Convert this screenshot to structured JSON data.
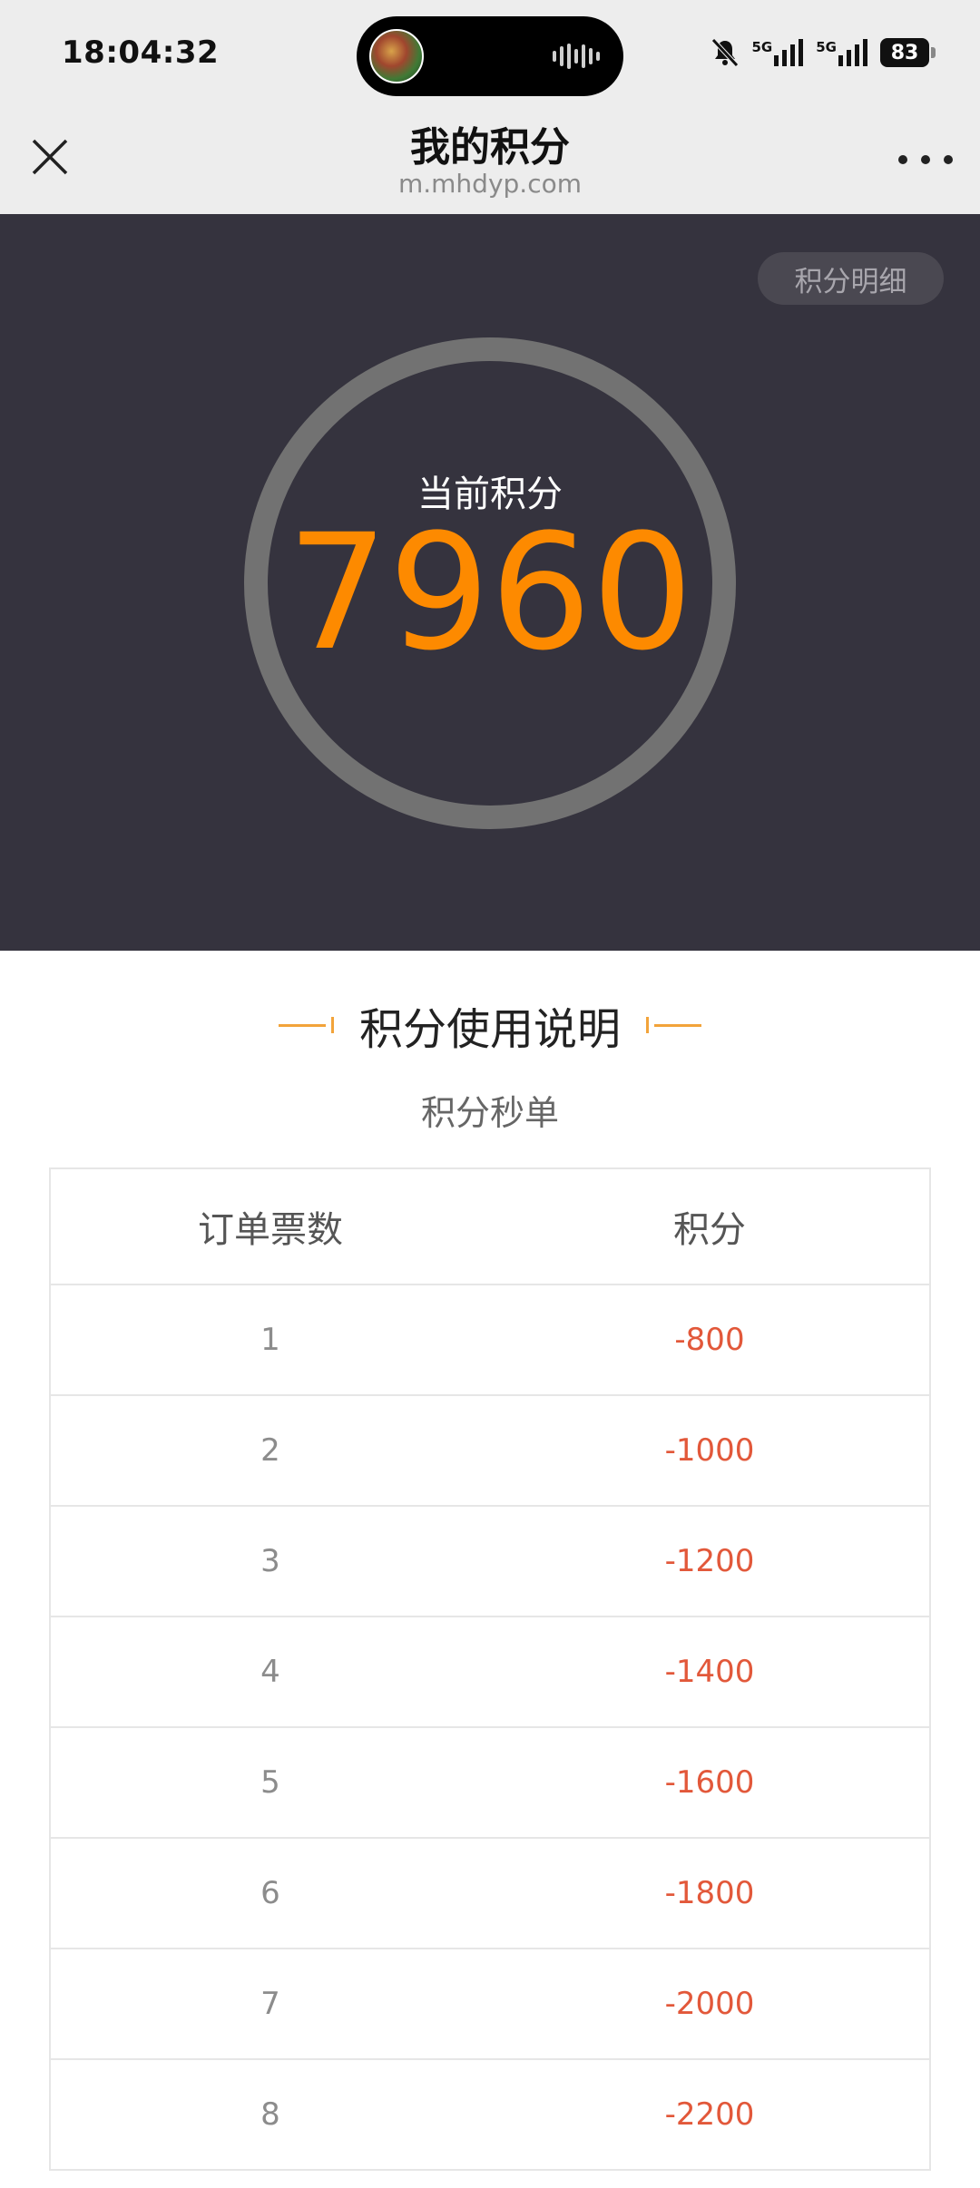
{
  "status_bar": {
    "time": "18:04:32",
    "network1": "5G",
    "network2": "5G",
    "battery": "83",
    "icons": [
      "bell-muted-icon",
      "signal-icon",
      "signal-icon",
      "battery-icon"
    ]
  },
  "nav": {
    "title": "我的积分",
    "subtitle": "m.mhdyp.com"
  },
  "hero": {
    "detail_button": "积分明细",
    "label": "当前积分",
    "points": "7960"
  },
  "section": {
    "title": "积分使用说明",
    "subtitle": "积分秒单"
  },
  "table": {
    "headers": [
      "订单票数",
      "积分"
    ],
    "rows": [
      {
        "tickets": "1",
        "points": "-800"
      },
      {
        "tickets": "2",
        "points": "-1000"
      },
      {
        "tickets": "3",
        "points": "-1200"
      },
      {
        "tickets": "4",
        "points": "-1400"
      },
      {
        "tickets": "5",
        "points": "-1600"
      },
      {
        "tickets": "6",
        "points": "-1800"
      },
      {
        "tickets": "7",
        "points": "-2000"
      },
      {
        "tickets": "8",
        "points": "-2200"
      }
    ]
  },
  "colors": {
    "hero_bg": "#35333e",
    "accent_orange": "#fd8a00",
    "points_red": "#e2583a"
  }
}
